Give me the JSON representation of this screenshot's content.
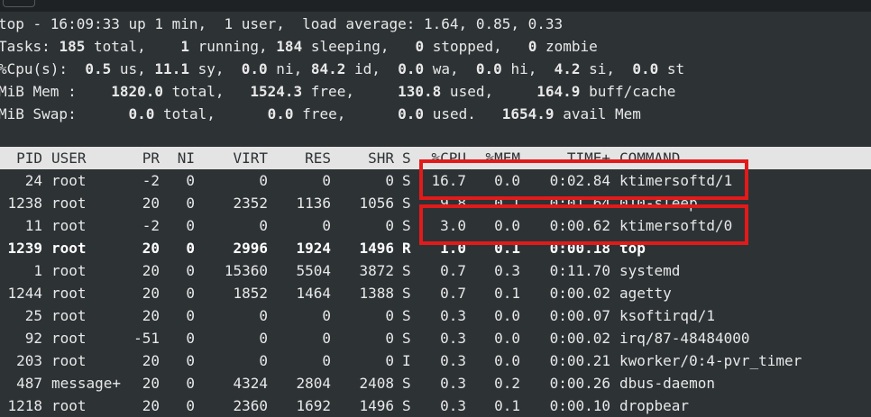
{
  "summary": {
    "top": {
      "prefix": "top - ",
      "time": "16:09:33",
      "up": " up ",
      "uptime": "1 min,",
      "users": "  1 user,",
      "load_label": "  load average: ",
      "load": "1.64, 0.85, 0.33"
    },
    "tasks": {
      "label": "Tasks: ",
      "total": "185",
      "total_l": " total,",
      "running": "1",
      "running_l": " running,",
      "sleeping": "184",
      "sleeping_l": " sleeping,",
      "stopped": "0",
      "stopped_l": " stopped,",
      "zombie": "0",
      "zombie_l": " zombie"
    },
    "cpu": {
      "label": "%Cpu(s): ",
      "us": "0.5",
      "us_l": " us, ",
      "sy": "11.1",
      "sy_l": " sy, ",
      "ni": "0.0",
      "ni_l": " ni, ",
      "id": "84.2",
      "id_l": " id, ",
      "wa": "0.0",
      "wa_l": " wa, ",
      "hi": "0.0",
      "hi_l": " hi, ",
      "si": "4.2",
      "si_l": " si, ",
      "st": "0.0",
      "st_l": " st"
    },
    "mem": {
      "label": "MiB Mem : ",
      "total": "1820.0",
      "total_l": " total, ",
      "free": "1524.3",
      "free_l": " free, ",
      "used": "130.8",
      "used_l": " used, ",
      "buff": "164.9",
      "buff_l": " buff/cache"
    },
    "swap": {
      "label": "MiB Swap: ",
      "total": "0.0",
      "total_l": " total, ",
      "free": "0.0",
      "free_l": " free, ",
      "used": "0.0",
      "used_l": " used. ",
      "avail": "1654.9",
      "avail_l": " avail Mem"
    }
  },
  "columns": [
    "PID",
    "USER",
    "PR",
    "NI",
    "VIRT",
    "RES",
    "SHR",
    "S",
    "%CPU",
    "%MEM",
    "TIME+",
    "COMMAND"
  ],
  "processes": [
    {
      "pid": "24",
      "user": "root",
      "pr": "-2",
      "ni": "0",
      "virt": "0",
      "res": "0",
      "shr": "0",
      "s": "S",
      "cpu": "16.7",
      "mem": "0.0",
      "time": "0:02.84",
      "cmd": "ktimersoftd/1",
      "bold": false
    },
    {
      "pid": "1238",
      "user": "root",
      "pr": "20",
      "ni": "0",
      "virt": "2352",
      "res": "1136",
      "shr": "1056",
      "s": "S",
      "cpu": "9.8",
      "mem": "0.1",
      "time": "0:01.64",
      "cmd": "010-sleep",
      "bold": false
    },
    {
      "pid": "11",
      "user": "root",
      "pr": "-2",
      "ni": "0",
      "virt": "0",
      "res": "0",
      "shr": "0",
      "s": "S",
      "cpu": "3.0",
      "mem": "0.0",
      "time": "0:00.62",
      "cmd": "ktimersoftd/0",
      "bold": false
    },
    {
      "pid": "1239",
      "user": "root",
      "pr": "20",
      "ni": "0",
      "virt": "2996",
      "res": "1924",
      "shr": "1496",
      "s": "R",
      "cpu": "1.0",
      "mem": "0.1",
      "time": "0:00.18",
      "cmd": "top",
      "bold": true
    },
    {
      "pid": "1",
      "user": "root",
      "pr": "20",
      "ni": "0",
      "virt": "15360",
      "res": "5504",
      "shr": "3872",
      "s": "S",
      "cpu": "0.7",
      "mem": "0.3",
      "time": "0:11.70",
      "cmd": "systemd",
      "bold": false
    },
    {
      "pid": "1244",
      "user": "root",
      "pr": "20",
      "ni": "0",
      "virt": "1852",
      "res": "1464",
      "shr": "1388",
      "s": "S",
      "cpu": "0.7",
      "mem": "0.1",
      "time": "0:00.02",
      "cmd": "agetty",
      "bold": false
    },
    {
      "pid": "25",
      "user": "root",
      "pr": "20",
      "ni": "0",
      "virt": "0",
      "res": "0",
      "shr": "0",
      "s": "S",
      "cpu": "0.3",
      "mem": "0.0",
      "time": "0:00.07",
      "cmd": "ksoftirqd/1",
      "bold": false
    },
    {
      "pid": "92",
      "user": "root",
      "pr": "-51",
      "ni": "0",
      "virt": "0",
      "res": "0",
      "shr": "0",
      "s": "S",
      "cpu": "0.3",
      "mem": "0.0",
      "time": "0:00.02",
      "cmd": "irq/87-48484000",
      "bold": false
    },
    {
      "pid": "203",
      "user": "root",
      "pr": "20",
      "ni": "0",
      "virt": "0",
      "res": "0",
      "shr": "0",
      "s": "I",
      "cpu": "0.3",
      "mem": "0.0",
      "time": "0:00.21",
      "cmd": "kworker/0:4-pvr_timer",
      "bold": false
    },
    {
      "pid": "487",
      "user": "message+",
      "pr": "20",
      "ni": "0",
      "virt": "4324",
      "res": "2804",
      "shr": "2408",
      "s": "S",
      "cpu": "0.3",
      "mem": "0.2",
      "time": "0:00.26",
      "cmd": "dbus-daemon",
      "bold": false
    },
    {
      "pid": "1218",
      "user": "root",
      "pr": "20",
      "ni": "0",
      "virt": "2360",
      "res": "1692",
      "shr": "1496",
      "s": "S",
      "cpu": "0.3",
      "mem": "0.1",
      "time": "0:00.10",
      "cmd": "dropbear",
      "bold": false
    }
  ],
  "highlights": [
    "ktimersoftd/1",
    "ktimersoftd/0"
  ],
  "colors": {
    "background": "#2d3235",
    "header_bg": "#e4e4e4",
    "highlight_border": "#e21a1a"
  }
}
